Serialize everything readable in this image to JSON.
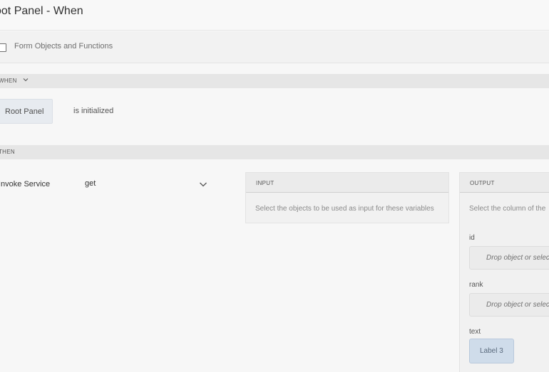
{
  "header": {
    "title": "oot Panel - When"
  },
  "toolbar": {
    "checkbox_label": "Form Objects and Functions"
  },
  "when": {
    "label": "WHEN",
    "component_chip": "Root Panel",
    "condition": "is initialized"
  },
  "then": {
    "label": "THEN",
    "action": "Invoke Service",
    "service_value": "get"
  },
  "input_panel": {
    "header": "INPUT",
    "hint": "Select the objects to be used as input for these variables"
  },
  "output_panel": {
    "header": "OUTPUT",
    "hint": "Select the column of the",
    "fields": [
      {
        "label": "id",
        "placeholder": "Drop object or selec"
      },
      {
        "label": "rank",
        "placeholder": "Drop object or selec"
      },
      {
        "label": "text",
        "value": "Label 3"
      }
    ]
  },
  "colors": {
    "section_bg": "#e6e6e6",
    "chip_bg": "#e7ebf0",
    "selected_chip_bg": "#cfdcea"
  }
}
